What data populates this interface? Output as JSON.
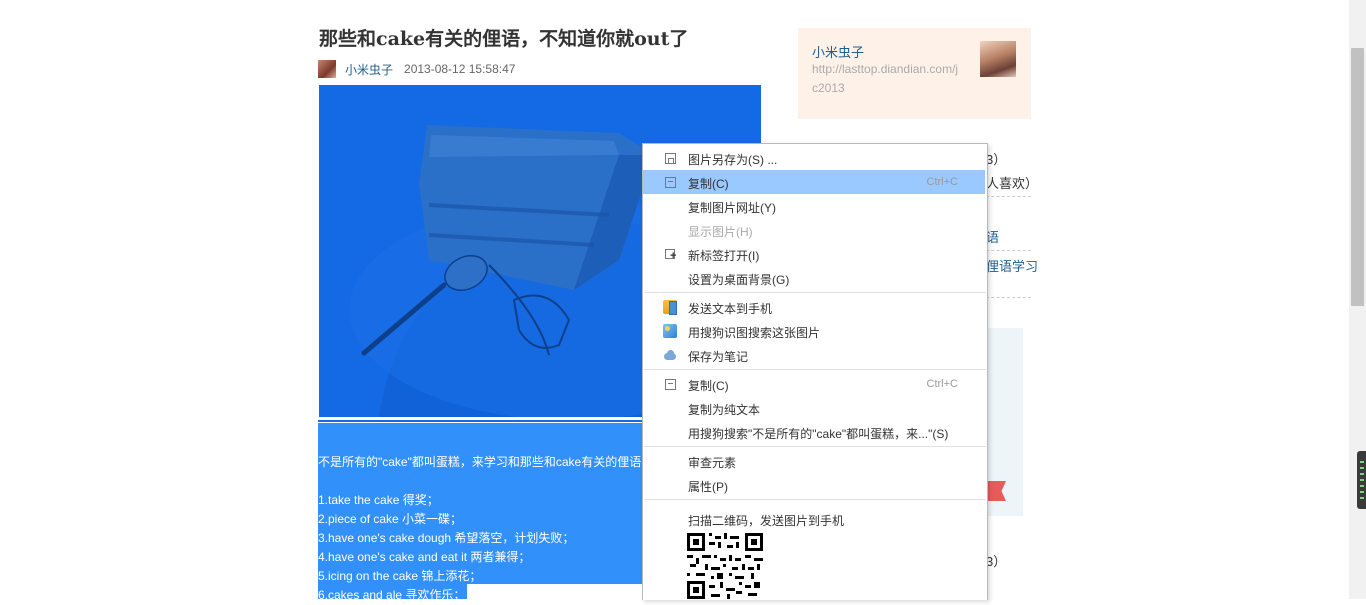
{
  "article": {
    "title": "那些和cake有关的俚语，不知道你就out了",
    "author": "小米虫子",
    "date": "2013-08-12 15:58:47",
    "body_lines": [
      "不是所有的\"cake\"都叫蛋糕，来学习和那些和cake有关的俚语",
      "",
      "1.take the cake 得奖；",
      "2.piece of cake 小菜一碟；",
      "3.have one's cake dough 希望落空，计划失败；",
      "4.have one's cake and eat it 两者兼得；",
      "5.icing on the cake 锦上添花；",
      "6.cakes and ale 寻欢作乐；"
    ]
  },
  "sidebar": {
    "profile_name": "小米虫子",
    "profile_url": "http://lasttop.diandian.com/jc2013",
    "fragments": [
      "3）",
      "人喜欢）",
      "语",
      "俚语学习",
      "3）"
    ]
  },
  "context_menu": {
    "items": [
      {
        "label": "图片另存为(S) ...",
        "icon": "save-image-icon"
      },
      {
        "label": "复制(C)",
        "shortcut": "Ctrl+C",
        "icon": "copy-icon",
        "highlighted": true
      },
      {
        "label": "复制图片网址(Y)"
      },
      {
        "label": "显示图片(H)",
        "disabled": true
      },
      {
        "label": "新标签打开(I)",
        "icon": "new-tab-icon"
      },
      {
        "label": "设置为桌面背景(G)"
      },
      {
        "label": "发送文本到手机",
        "icon": "send-to-phone-icon"
      },
      {
        "label": "用搜狗识图搜索这张图片",
        "icon": "image-search-icon"
      },
      {
        "label": "保存为笔记",
        "icon": "cloud-note-icon"
      },
      {
        "label": "复制(C)",
        "shortcut": "Ctrl+C",
        "icon": "copy-icon"
      },
      {
        "label": "复制为纯文本"
      },
      {
        "label": "用搜狗搜索\"不是所有的\"cake\"都叫蛋糕，来...\"(S)"
      },
      {
        "label": "审查元素"
      },
      {
        "label": "属性(P)"
      },
      {
        "label": "扫描二维码，发送图片到手机"
      }
    ]
  },
  "colors": {
    "selection": "#3290fa",
    "image_overlay": "#1469e4",
    "menu_highlight": "#99c9ff",
    "link": "#1f5d8f",
    "profile_bg": "#fef2e8"
  }
}
